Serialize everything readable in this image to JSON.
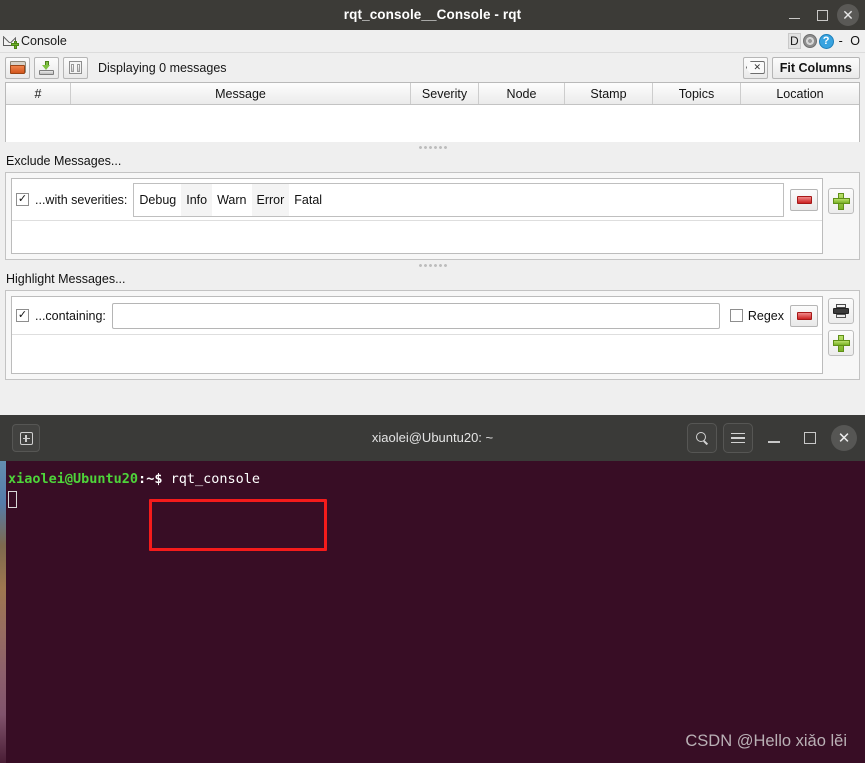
{
  "rqt": {
    "window_title": "rqt_console__Console - rqt",
    "window_buttons": {
      "minimize": "–",
      "maximize": "□",
      "close": "✕"
    },
    "tab": {
      "label": "Console",
      "dock_letter": "D",
      "help_glyph": "?",
      "extra": "- O"
    },
    "toolbar": {
      "open_tooltip": "open-file",
      "save_tooltip": "save-file",
      "pause_tooltip": "pause",
      "status": "Displaying 0 messages",
      "fit_columns_label": "Fit Columns",
      "clear_tooltip": "clear-messages"
    },
    "table": {
      "columns": [
        "#",
        "Message",
        "Severity",
        "Node",
        "Stamp",
        "Topics",
        "Location"
      ],
      "widths": [
        65,
        340,
        68,
        86,
        88,
        88,
        96
      ],
      "rows": []
    },
    "exclude": {
      "section_label": "Exclude Messages...",
      "row_enabled": true,
      "checkmark": "✓",
      "row_label": "...with severities:",
      "severities": [
        "Debug",
        "Info",
        "Warn",
        "Error",
        "Fatal"
      ],
      "remove_tooltip": "remove-exclude-filter",
      "add_tooltip": "add-exclude-filter"
    },
    "highlight": {
      "section_label": "Highlight Messages...",
      "row_enabled": true,
      "checkmark": "✓",
      "row_label": "...containing:",
      "input_value": "",
      "input_placeholder": "",
      "regex_label": "Regex",
      "regex_checked": false,
      "remove_tooltip": "remove-highlight-filter",
      "print_tooltip": "highlight-settings",
      "add_tooltip": "add-highlight-filter"
    }
  },
  "terminal": {
    "title": "xiaolei@Ubuntu20: ~",
    "new_tab_tooltip": "new-tab",
    "search_tooltip": "search",
    "menu_tooltip": "menu",
    "window_buttons": {
      "minimize": "–",
      "maximize": "□",
      "close": "✕"
    },
    "prompt_user": "xiaolei@Ubuntu20",
    "prompt_sep": ":",
    "prompt_path": "~",
    "prompt_dollar": "$ ",
    "command": "rqt_console"
  },
  "watermark": "CSDN @Hello xiǎo lĕi",
  "colors": {
    "titlebar": "#3c3b37",
    "terminal_bg": "#380d25",
    "highlight_box": "#f41b1b",
    "prompt_green": "#4ed43a",
    "accent_blue": "#38a3e0"
  }
}
